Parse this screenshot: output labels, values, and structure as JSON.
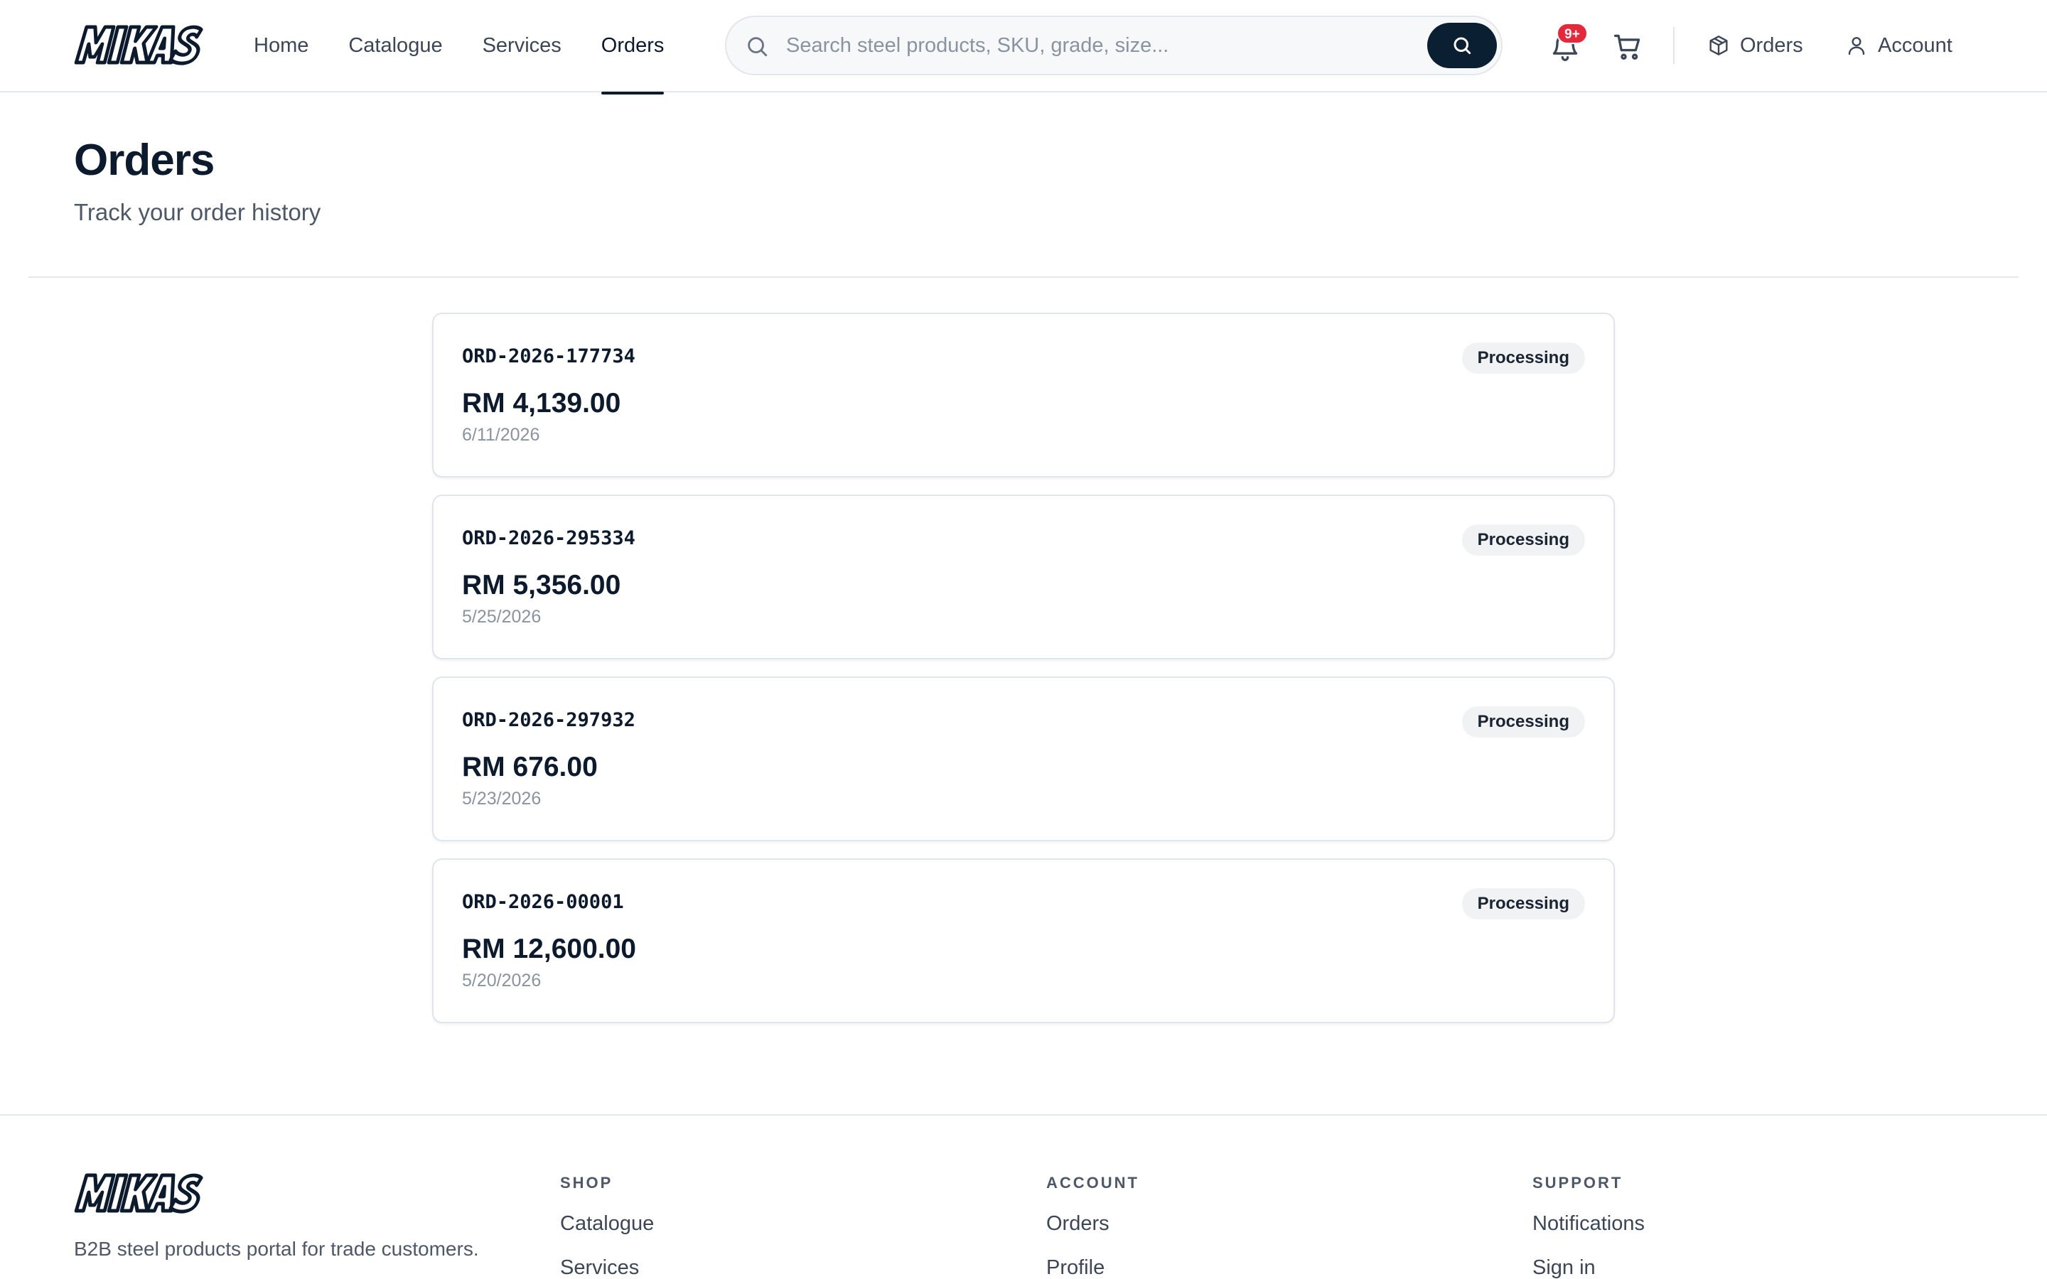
{
  "brand": {
    "name": "MIKAS"
  },
  "nav": {
    "items": [
      {
        "label": "Home",
        "active": false
      },
      {
        "label": "Catalogue",
        "active": false
      },
      {
        "label": "Services",
        "active": false
      },
      {
        "label": "Orders",
        "active": true
      }
    ]
  },
  "search": {
    "placeholder": "Search steel products, SKU, grade, size...",
    "value": ""
  },
  "header": {
    "notifications_badge": "9+",
    "orders_label": "Orders",
    "account_label": "Account"
  },
  "page": {
    "title": "Orders",
    "subtitle": "Track your order history"
  },
  "orders": [
    {
      "id": "ORD-2026-177734",
      "amount": "RM 4,139.00",
      "date": "6/11/2026",
      "status": "Processing"
    },
    {
      "id": "ORD-2026-295334",
      "amount": "RM 5,356.00",
      "date": "5/25/2026",
      "status": "Processing"
    },
    {
      "id": "ORD-2026-297932",
      "amount": "RM 676.00",
      "date": "5/23/2026",
      "status": "Processing"
    },
    {
      "id": "ORD-2026-00001",
      "amount": "RM 12,600.00",
      "date": "5/20/2026",
      "status": "Processing"
    }
  ],
  "footer": {
    "tagline": "B2B steel products portal for trade customers.",
    "columns": [
      {
        "heading": "SHOP",
        "links": [
          "Catalogue",
          "Services"
        ]
      },
      {
        "heading": "ACCOUNT",
        "links": [
          "Orders",
          "Profile"
        ]
      },
      {
        "heading": "SUPPORT",
        "links": [
          "Notifications",
          "Sign in"
        ]
      }
    ]
  },
  "colors": {
    "primary": "#0b1f33",
    "text": "#0c1a2e",
    "muted": "#8a93a0",
    "badge_red": "#e5293a",
    "border": "#e1e4e8"
  },
  "icons": [
    "search-icon",
    "bell-icon",
    "cart-icon",
    "box-icon",
    "user-icon"
  ]
}
